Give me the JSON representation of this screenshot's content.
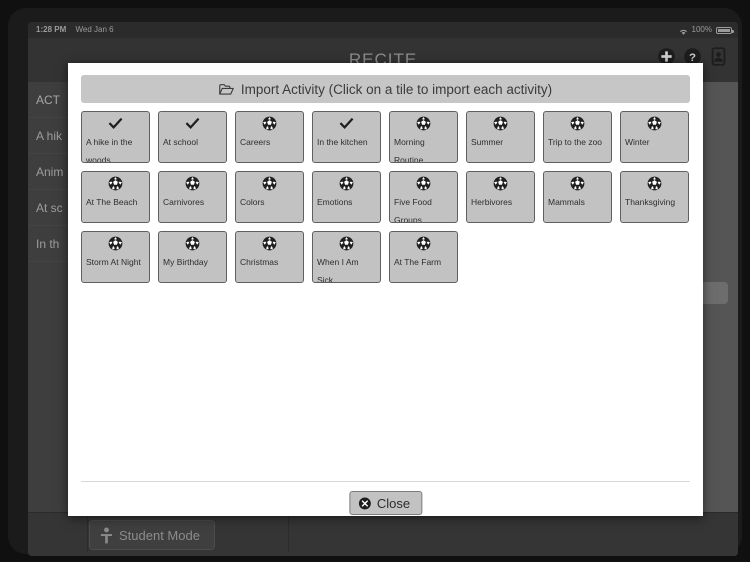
{
  "status_bar": {
    "time": "1:28 PM",
    "date": "Wed Jan 6",
    "battery_percent": "100%",
    "wifi_icon": "wifi-icon",
    "battery_icon": "battery-full-icon"
  },
  "header": {
    "app_title": "RECITE",
    "icons": [
      {
        "name": "add-circle-icon",
        "label": "Add"
      },
      {
        "name": "help-circle-icon",
        "label": "Help"
      },
      {
        "name": "user-card-icon",
        "label": "Profile"
      }
    ]
  },
  "background": {
    "left_list": [
      {
        "label": "ACT"
      },
      {
        "label": "A hik"
      },
      {
        "label": "Anim"
      },
      {
        "label": "At sc"
      },
      {
        "label": "In th"
      }
    ],
    "student_mode_label": "Student Mode",
    "student_mode_icon": "person-icon"
  },
  "modal": {
    "header_title": "Import Activity (Click on a tile to import each activity)",
    "header_icon": "folder-open-icon",
    "close_label": "Close",
    "close_icon": "close-circle-icon",
    "tiles": [
      {
        "label": "A hike in the woods",
        "icon": "check-icon"
      },
      {
        "label": "At school",
        "icon": "check-icon"
      },
      {
        "label": "Careers",
        "icon": "soccer-ball-icon"
      },
      {
        "label": "In the kitchen",
        "icon": "check-icon"
      },
      {
        "label": "Morning Routine",
        "icon": "soccer-ball-icon"
      },
      {
        "label": "Summer",
        "icon": "soccer-ball-icon"
      },
      {
        "label": "Trip to the zoo",
        "icon": "soccer-ball-icon"
      },
      {
        "label": "Winter",
        "icon": "soccer-ball-icon"
      },
      {
        "label": "At The Beach",
        "icon": "soccer-ball-icon"
      },
      {
        "label": "Carnivores",
        "icon": "soccer-ball-icon"
      },
      {
        "label": "Colors",
        "icon": "soccer-ball-icon"
      },
      {
        "label": "Emotions",
        "icon": "soccer-ball-icon"
      },
      {
        "label": "Five Food Groups",
        "icon": "soccer-ball-icon"
      },
      {
        "label": "Herbivores",
        "icon": "soccer-ball-icon"
      },
      {
        "label": "Mammals",
        "icon": "soccer-ball-icon"
      },
      {
        "label": "Thanksgiving",
        "icon": "soccer-ball-icon"
      },
      {
        "label": "Storm At Night",
        "icon": "soccer-ball-icon"
      },
      {
        "label": "My Birthday",
        "icon": "soccer-ball-icon"
      },
      {
        "label": "Christmas",
        "icon": "soccer-ball-icon"
      },
      {
        "label": "When I Am Sick",
        "icon": "soccer-ball-icon"
      },
      {
        "label": "At The Farm",
        "icon": "soccer-ball-icon"
      }
    ]
  },
  "colors": {
    "modal_bg": "#ffffff",
    "tile_bg": "#c2c2c2",
    "tile_border": "#606060",
    "header_bg": "#c6c6c6",
    "app_chrome": "#333333"
  }
}
